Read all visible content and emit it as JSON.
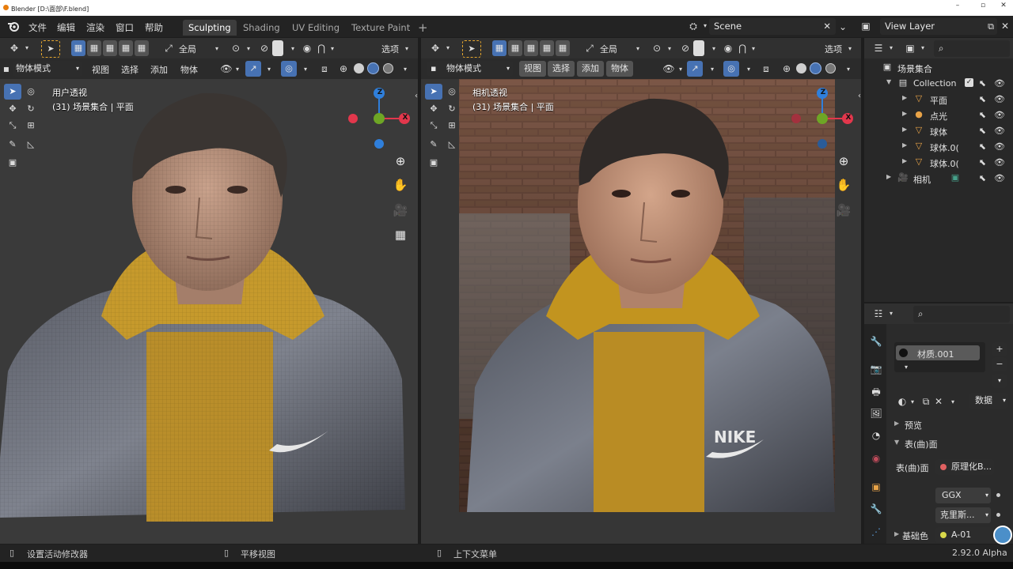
{
  "os_title": "Blender [D:\\面部\\F.blend]",
  "window_controls": [
    "–",
    "▫",
    "✕"
  ],
  "menus": [
    "文件",
    "编辑",
    "渲染",
    "窗口",
    "帮助"
  ],
  "workspace_tabs": [
    "Sculpting",
    "Shading",
    "UV Editing",
    "Texture Paint"
  ],
  "add_workspace": "+",
  "scene": {
    "name": "Scene",
    "clear": "✕",
    "chevron": "⌄"
  },
  "view_layer": {
    "name": "View Layer"
  },
  "viewport_left": {
    "transform_orientation": "全局",
    "options": "选项",
    "mode": "物体模式",
    "menus": [
      "视图",
      "选择",
      "添加",
      "物体"
    ],
    "hud_line1": "用户透视",
    "hud_line2": "(31) 场景集合 | 平面"
  },
  "viewport_right": {
    "transform_orientation": "全局",
    "options": "选项",
    "mode": "物体模式",
    "menus": [
      "视图",
      "选择",
      "添加",
      "物体"
    ],
    "hud_line1": "相机透视",
    "hud_line2": "(31) 场景集合 | 平面"
  },
  "gizmo": {
    "z": "Z",
    "x": "X",
    "colors": {
      "x": "#e2374c",
      "y": "#6ea625",
      "z": "#2f7fdb"
    }
  },
  "outliner": {
    "root": "场景集合",
    "collection": "Collection",
    "items": [
      {
        "label": "平面",
        "icon": "mesh-icon"
      },
      {
        "label": "点光",
        "icon": "light-icon"
      },
      {
        "label": "球体",
        "icon": "mesh-icon"
      },
      {
        "label": "球体.0(",
        "icon": "mesh-icon"
      },
      {
        "label": "球体.0(",
        "icon": "mesh-icon"
      }
    ],
    "camera": "相机"
  },
  "properties": {
    "material_slot": "材质.001",
    "data_label": "数据",
    "preview": "预览",
    "surface_panel": "表(曲)面",
    "surface_label": "表(曲)面",
    "surface_value": "原理化B...",
    "distribution": "GGX",
    "subsurface_method": "克里斯...",
    "base_color_label": "基础色",
    "base_color_value": "A-01"
  },
  "status": {
    "left": "设置活动修改器",
    "middle": "平移视图",
    "right": "上下文菜单",
    "version": "2.92.0 Alpha"
  },
  "nike_text": "NIKE"
}
